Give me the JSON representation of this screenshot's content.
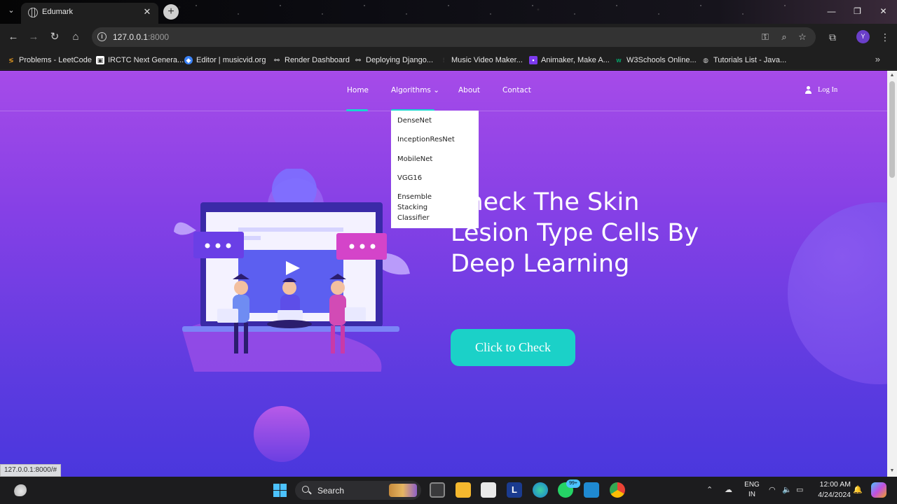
{
  "browser": {
    "tab": {
      "title": "Edumark"
    },
    "url": {
      "host": "127.0.0.1",
      "port": ":8000"
    },
    "bookmarks": [
      {
        "label": "Problems - LeetCode",
        "icon": "leetcode-icon",
        "color": "#f0a020"
      },
      {
        "label": "IRCTC Next Genera...",
        "icon": "irctc-icon",
        "color": "#ffffff"
      },
      {
        "label": "Editor | musicvid.org",
        "icon": "musicvid-icon",
        "color": "#3b82f6"
      },
      {
        "label": "Render Dashboard",
        "icon": "render-icon",
        "color": "#ffffff"
      },
      {
        "label": "Deploying Django...",
        "icon": "render-icon",
        "color": "#ffffff"
      },
      {
        "label": "Music Video Maker...",
        "icon": "waveform-icon",
        "color": "#888888"
      },
      {
        "label": "Animaker, Make A...",
        "icon": "animaker-icon",
        "color": "#7c3aed"
      },
      {
        "label": "W3Schools Online...",
        "icon": "w3schools-icon",
        "color": "#04aa6d"
      },
      {
        "label": "Tutorials List - Java...",
        "icon": "globe-icon",
        "color": "#cccccc"
      }
    ],
    "status_url": "127.0.0.1:8000/#",
    "profile_initial": "Y"
  },
  "site": {
    "nav": {
      "home": "Home",
      "algorithms": "Algorithms",
      "about": "About",
      "contact": "Contact",
      "login": "Log In"
    },
    "dropdown": [
      "DenseNet",
      "InceptionResNet",
      "MobileNet",
      "VGG16",
      "Ensemble Stacking Classifier"
    ],
    "hero": {
      "title": "Check The Skin Lesion Type Cells By Deep Learning",
      "button": "Click to Check"
    },
    "colors": {
      "accent": "#1bd1c8",
      "gradient_top": "#a64be8",
      "gradient_bottom": "#4a37dd"
    }
  },
  "taskbar": {
    "search_placeholder": "Search",
    "whatsapp_badge": "99+",
    "lang_line1": "ENG",
    "lang_line2": "IN",
    "time": "12:00 AM",
    "date": "4/24/2024"
  }
}
